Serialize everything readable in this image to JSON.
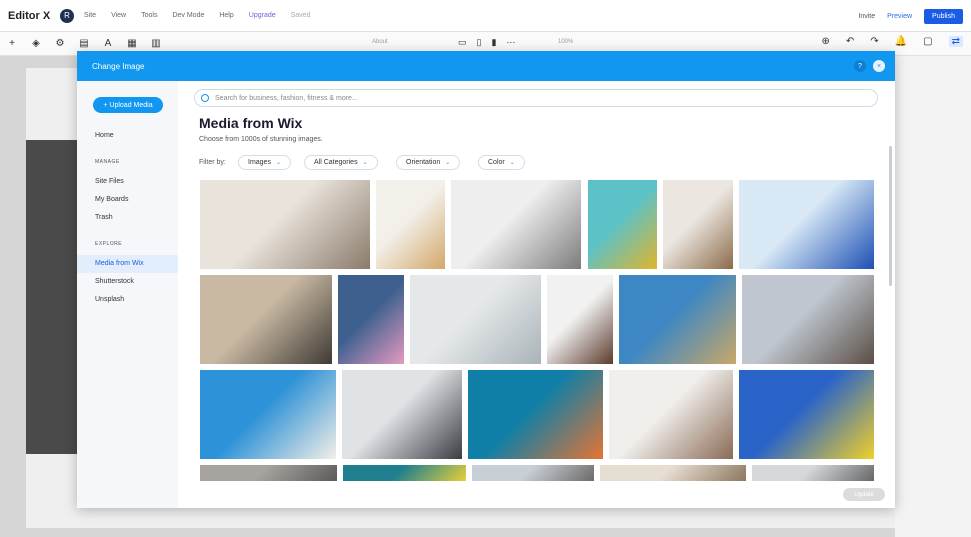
{
  "app": {
    "brand": "Editor X",
    "avatar_initial": "R",
    "menu": [
      "Site",
      "View",
      "Tools",
      "Dev Mode",
      "Help",
      "Upgrade",
      "Saved"
    ],
    "invite": "Invite",
    "preview": "Preview",
    "publish": "Publish"
  },
  "toolbar": {
    "page_label": "About",
    "zoom_label": "100%"
  },
  "dialog": {
    "title": "Change Image",
    "help_icon": "?",
    "close_icon": "×",
    "upload_button": "+ Upload Media",
    "nav": {
      "home": "Home",
      "manage_head": "MANAGE",
      "site_files": "Site Files",
      "my_boards": "My Boards",
      "trash": "Trash",
      "explore_head": "EXPLORE",
      "media_from_wix": "Media from Wix",
      "shutterstock": "Shutterstock",
      "unsplash": "Unsplash"
    },
    "search_placeholder": "Search for business, fashion, fitness & more...",
    "heading": "Media from Wix",
    "subheading": "Choose from 1000s of stunning images.",
    "filter_label": "Filter by:",
    "filters": [
      "Images",
      "All Categories",
      "Orientation",
      "Color"
    ],
    "update_button": "Update"
  },
  "images": [
    {
      "name": "two-women-meeting",
      "colors": [
        "#e9e3db",
        "#8a7b6b"
      ]
    },
    {
      "name": "lamp-on-books",
      "colors": [
        "#f3efe9",
        "#d2a86a"
      ]
    },
    {
      "name": "office-wheelchair",
      "colors": [
        "#eeeeee",
        "#7c7c7c"
      ]
    },
    {
      "name": "woman-yellow-coat",
      "colors": [
        "#5cc2c8",
        "#e0b52a"
      ]
    },
    {
      "name": "interior-plant",
      "colors": [
        "#ebe6df",
        "#8b6b4a"
      ]
    },
    {
      "name": "runner-beach",
      "colors": [
        "#d8e9f5",
        "#1d4fb6"
      ]
    },
    {
      "name": "cafe-workspace",
      "colors": [
        "#c9b9a3",
        "#3f3a33"
      ]
    },
    {
      "name": "twins-mountain",
      "colors": [
        "#3c5f8e",
        "#e59ac1"
      ]
    },
    {
      "name": "seaside-umbrellas",
      "colors": [
        "#e5e8e9",
        "#a9b3b8"
      ]
    },
    {
      "name": "woman-white-shirt",
      "colors": [
        "#f1f1f1",
        "#5b3b2c"
      ]
    },
    {
      "name": "beach-hammock",
      "colors": [
        "#3d87c4",
        "#c9a868"
      ]
    },
    {
      "name": "students-chatting",
      "colors": [
        "#bfc6cf",
        "#5b4e46"
      ]
    },
    {
      "name": "flower-vase-blue",
      "colors": [
        "#2d92d8",
        "#f4efe6"
      ]
    },
    {
      "name": "corridor-walkers",
      "colors": [
        "#dfe3e6",
        "#3a3d42"
      ]
    },
    {
      "name": "orange-flowers",
      "colors": [
        "#0f7fa7",
        "#e57434"
      ]
    },
    {
      "name": "couple-kitchen",
      "colors": [
        "#f0efec",
        "#8a6a55"
      ]
    },
    {
      "name": "ukraine-flag",
      "colors": [
        "#2b64c8",
        "#f0d02a"
      ]
    },
    {
      "name": "row4-a",
      "colors": [
        "#a7a39e",
        "#5a5a5a"
      ]
    },
    {
      "name": "row4-b",
      "colors": [
        "#1f7f8e",
        "#e5d03a"
      ]
    },
    {
      "name": "row4-c",
      "colors": [
        "#c9cfd6",
        "#6c6a6a"
      ]
    },
    {
      "name": "row4-d",
      "colors": [
        "#e7ded2",
        "#8d775f"
      ]
    },
    {
      "name": "row4-e",
      "colors": [
        "#d5d8db",
        "#666666"
      ]
    }
  ]
}
